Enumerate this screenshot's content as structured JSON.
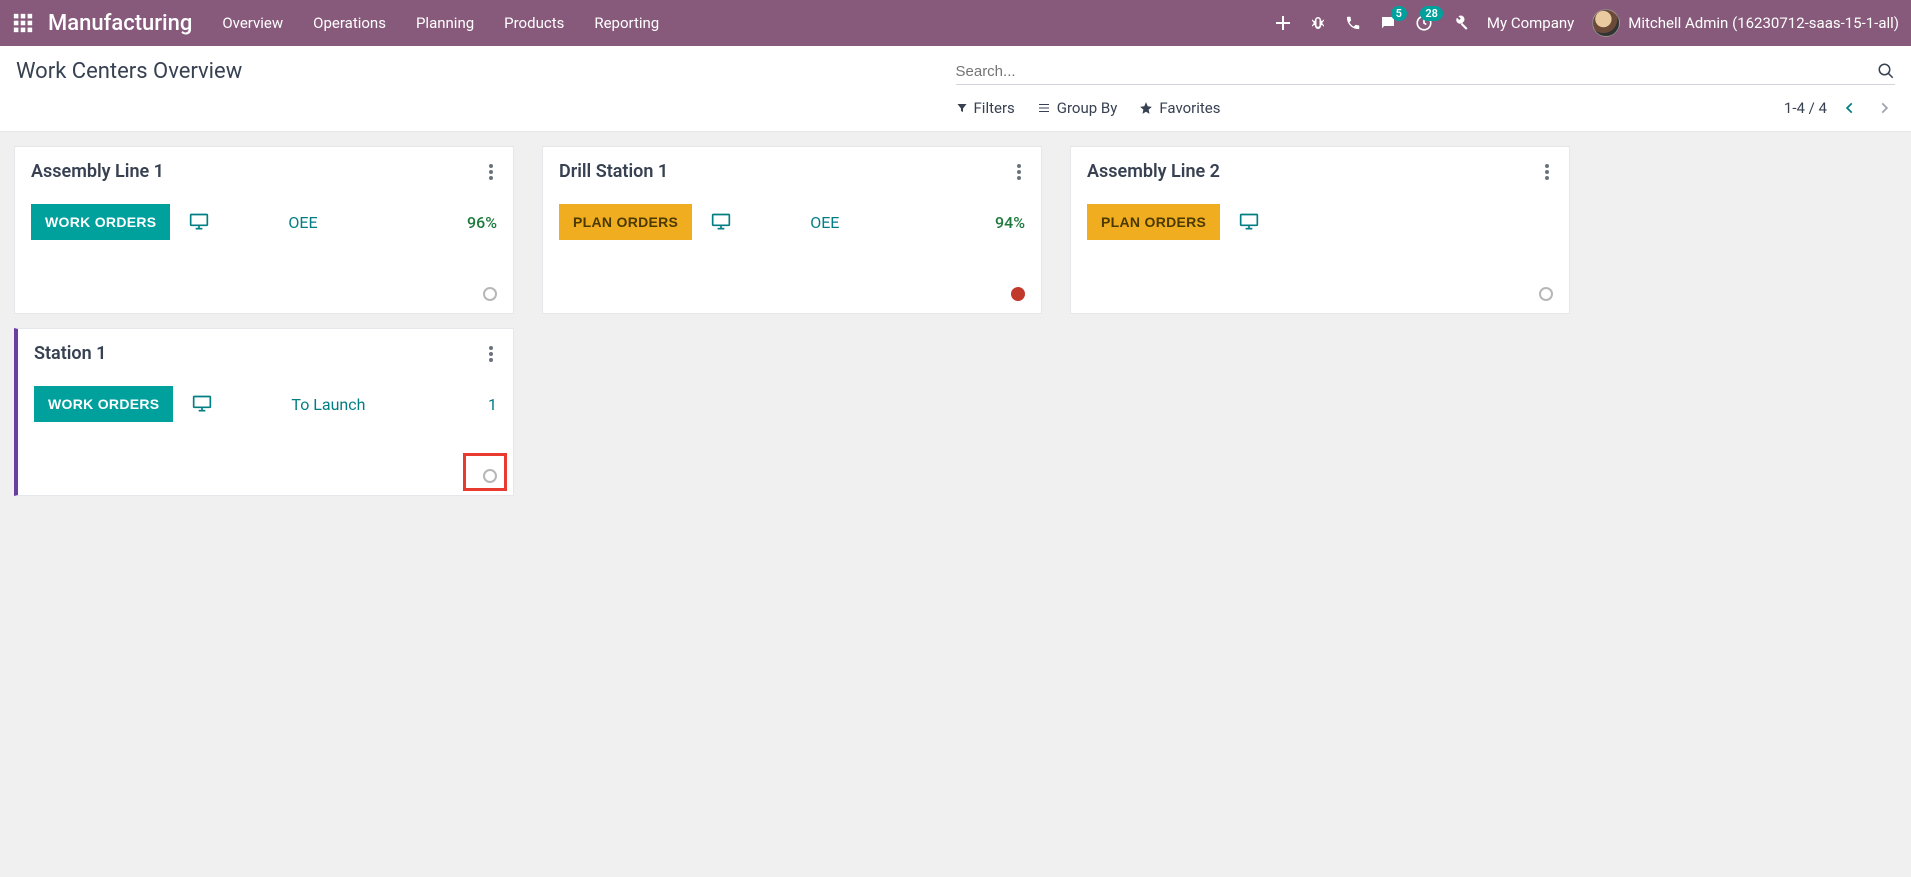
{
  "nav": {
    "brand": "Manufacturing",
    "menu": [
      "Overview",
      "Operations",
      "Planning",
      "Products",
      "Reporting"
    ],
    "messages_badge": "5",
    "activities_badge": "28",
    "company": "My Company",
    "user": "Mitchell Admin (16230712-saas-15-1-all)"
  },
  "control": {
    "title": "Work Centers Overview",
    "search_placeholder": "Search...",
    "filters_label": "Filters",
    "groupby_label": "Group By",
    "favorites_label": "Favorites",
    "pager": "1-4 / 4"
  },
  "cards": {
    "assembly1": {
      "title": "Assembly Line 1",
      "button": "WORK ORDERS",
      "metric_label": "OEE",
      "metric_value": "96%"
    },
    "drill1": {
      "title": "Drill Station 1",
      "button": "PLAN ORDERS",
      "metric_label": "OEE",
      "metric_value": "94%"
    },
    "assembly2": {
      "title": "Assembly Line 2",
      "button": "PLAN ORDERS"
    },
    "station1": {
      "title": "Station 1",
      "button": "WORK ORDERS",
      "metric_label": "To Launch",
      "metric_value": "1"
    }
  }
}
